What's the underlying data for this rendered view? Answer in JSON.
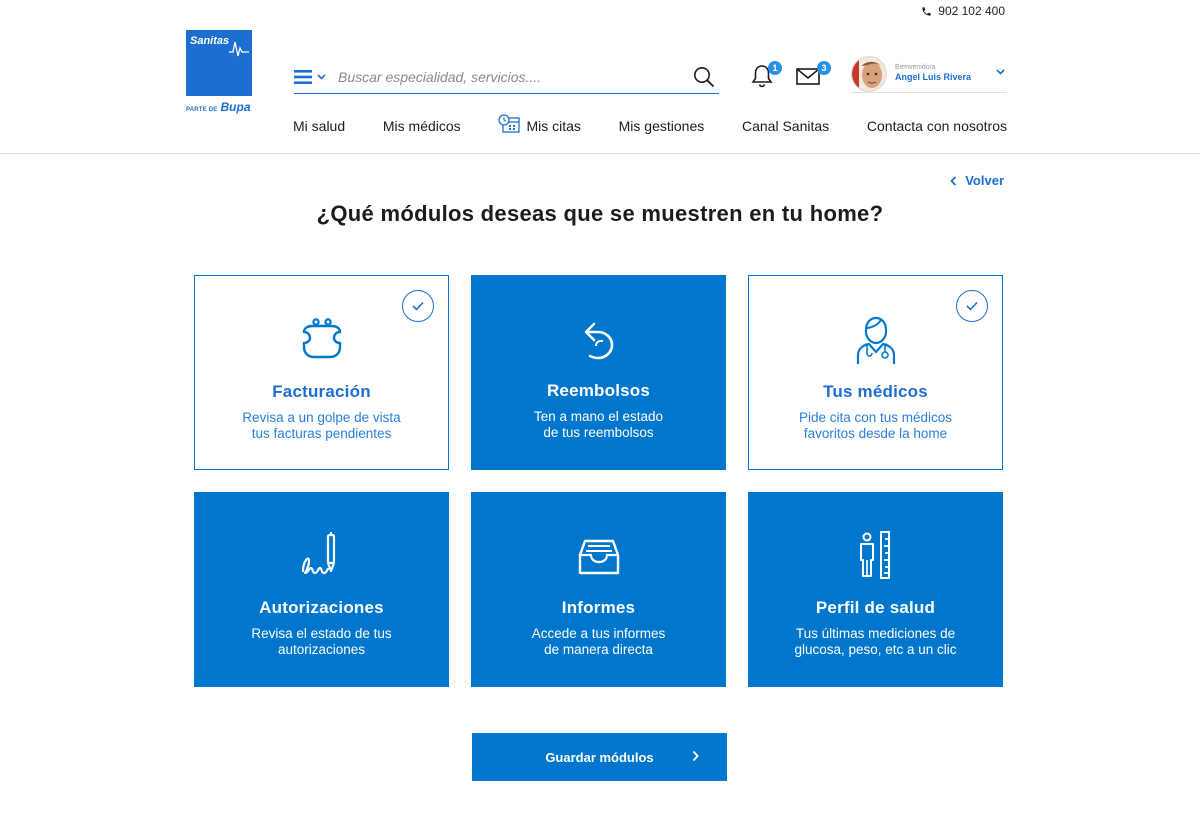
{
  "header": {
    "phone": "902 102 400",
    "logo": {
      "name": "Sanitas",
      "sub_prefix": "PARTE DE",
      "sub_brand": "Bupa"
    },
    "search": {
      "placeholder": "Buscar especialidad, servicios...."
    },
    "notifications": {
      "count": "1"
    },
    "messages": {
      "count": "3"
    },
    "user": {
      "welcome": "Bienvenido/a",
      "name": "Angel Luis Rivera"
    },
    "nav": [
      {
        "label": "Mi salud"
      },
      {
        "label": "Mis médicos"
      },
      {
        "label": "Mis citas",
        "icon": "calendar-clock-icon"
      },
      {
        "label": "Mis gestiones"
      },
      {
        "label": "Canal Sanitas"
      },
      {
        "label": "Contacta con nosotros"
      }
    ]
  },
  "main": {
    "back_label": "Volver",
    "title": "¿Qué módulos deseas que se muestren en tu home?",
    "modules": [
      {
        "title": "Facturación",
        "line1": "Revisa a un golpe de vista",
        "line2": "tus facturas pendientes",
        "selected": true,
        "icon": "purse-icon"
      },
      {
        "title": "Reembolsos",
        "line1": "Ten a mano el estado",
        "line2": "de tus reembolsos",
        "selected": false,
        "icon": "refund-arrow-icon"
      },
      {
        "title": "Tus médicos",
        "line1": "Pide cita con tus médicos",
        "line2": "favoritos desde la home",
        "selected": true,
        "icon": "doctor-icon"
      },
      {
        "title": "Autorizaciones",
        "line1": "Revisa el estado de tus",
        "line2": "autorizaciones",
        "selected": false,
        "icon": "signature-pen-icon"
      },
      {
        "title": "Informes",
        "line1": "Accede a tus informes",
        "line2": "de manera directa",
        "selected": false,
        "icon": "inbox-tray-icon"
      },
      {
        "title": "Perfil de salud",
        "line1": "Tus últimas mediciones de",
        "line2": "glucosa, peso, etc a un clic",
        "selected": false,
        "icon": "height-measure-icon"
      }
    ],
    "save_label": "Guardar módulos"
  },
  "colors": {
    "brand": "#1c6fd0",
    "card_blue": "#0077cc",
    "badge": "#2a8fe6"
  }
}
